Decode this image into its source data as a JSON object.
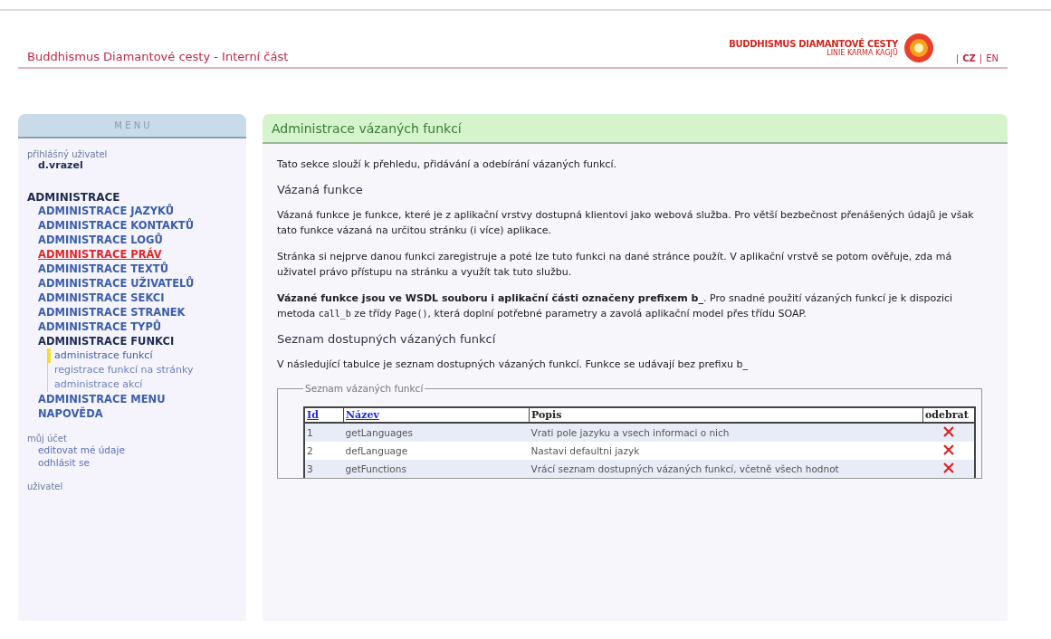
{
  "header": {
    "title": "Buddhismus Diamantové cesty - Interní část",
    "logo_text": "BUDDHISMUS DIAMANTOVÉ CESTY",
    "logo_subtitle": "LINIE KARMA KAGJÜ",
    "languages": [
      {
        "label": "CZ",
        "selected": true
      },
      {
        "label": "EN",
        "selected": false
      }
    ],
    "separator": "|"
  },
  "sidebar": {
    "title": "M E N U",
    "login_label": "přihlášný uživatel",
    "username": "d.vrazel",
    "section": "ADMINISTRACE",
    "items": [
      {
        "label": "ADMINISTRACE JAZYKŮ",
        "selected": false,
        "expanded": false
      },
      {
        "label": "ADMINISTRACE KONTAKTŮ",
        "selected": false,
        "expanded": false
      },
      {
        "label": "ADMINISTRACE LOGŮ",
        "selected": false,
        "expanded": false
      },
      {
        "label": "ADMINISTRACE PRÁV",
        "selected": true,
        "expanded": false
      },
      {
        "label": "ADMINISTRACE TEXTŮ",
        "selected": false,
        "expanded": false
      },
      {
        "label": "ADMINISTRACE UŽIVATELŮ",
        "selected": false,
        "expanded": false
      },
      {
        "label": "ADMINISTRACE SEKCI",
        "selected": false,
        "expanded": false
      },
      {
        "label": "ADMINISTRACE STRANEK",
        "selected": false,
        "expanded": false
      },
      {
        "label": "ADMINISTRACE TYPŮ",
        "selected": false,
        "expanded": false
      },
      {
        "label": "ADMINISTRACE FUNKCI",
        "selected": false,
        "expanded": true,
        "children": [
          {
            "label": "administrace funkcí",
            "selected": true
          },
          {
            "label": "registrace funkcí na stránky",
            "selected": false
          },
          {
            "label": "administrace akcí",
            "selected": false
          }
        ]
      },
      {
        "label": "ADMINISTRACE MENU",
        "selected": false,
        "expanded": false
      },
      {
        "label": "NAPOVĚDA",
        "selected": false,
        "expanded": false
      }
    ],
    "account_label": "můj účet",
    "account_links": [
      "editovat mé údaje",
      "odhlásit se"
    ],
    "user_label": "uživatel"
  },
  "main": {
    "title": "Administrace vázaných funkcí",
    "blocks": [
      {
        "kind": "para",
        "segments": [
          {
            "kind": "text",
            "text": "Tato sekce slouží k přehledu, přidávání a odebírání vázaných funkcí."
          }
        ]
      },
      {
        "kind": "heading",
        "text": "Vázaná funkce"
      },
      {
        "kind": "para",
        "segments": [
          {
            "kind": "text",
            "text": "Vázaná funkce je funkce, které je z aplikační vrstvy dostupná klientovi jako webová služba. Pro větší bezbečnost přenášených údajů je však tato funkce vázaná na určitou stránku (i více) aplikace."
          }
        ]
      },
      {
        "kind": "para",
        "segments": [
          {
            "kind": "text",
            "text": "Stránka si nejprve danou funkci zaregistruje a poté lze tuto funkci na dané stránce použít. V aplikační vrstvě se potom ověřuje, zda má uživatel právo přístupu na stránku a využít tak tuto službu."
          }
        ]
      },
      {
        "kind": "para",
        "segments": [
          {
            "kind": "text",
            "text": "**Vázané funkce jsou ve WSDL souboru i aplikační části označeny prefixem b_**. Pro snadné použití vázaných funkcí je k dispozici metoda "
          },
          {
            "kind": "code",
            "text": "call_b"
          },
          {
            "kind": "text",
            "text": " ze třídy "
          },
          {
            "kind": "code",
            "text": "Page()"
          },
          {
            "kind": "text",
            "text": ", která doplní potřebné parametry a zavolá aplikační model přes třídu SOAP."
          }
        ]
      },
      {
        "kind": "heading",
        "text": "Seznam dostupných vázaných funkcí"
      },
      {
        "kind": "para",
        "segments": [
          {
            "kind": "text",
            "text": "V následující tabulce je seznam dostupných vázaných funkcí. Funkce se udávají bez prefixu b_"
          }
        ]
      }
    ],
    "table": {
      "legend": "Seznam vázaných funkcí",
      "columns": [
        {
          "label": "Id",
          "sortable": true
        },
        {
          "label": "Název",
          "sortable": true
        },
        {
          "label": "Popis",
          "sortable": false
        },
        {
          "label": "odebrat",
          "sortable": false
        }
      ],
      "rows": [
        {
          "id": "1",
          "name": "getLanguages",
          "description": "Vrati pole jazyku a vsech informaci o nich"
        },
        {
          "id": "2",
          "name": "defLanguage",
          "description": "Nastavi defaultni jazyk"
        },
        {
          "id": "3",
          "name": "getFunctions",
          "description": "Vrácí seznam dostupných vázaných funkcí, včetně všech hodnot"
        }
      ]
    }
  }
}
